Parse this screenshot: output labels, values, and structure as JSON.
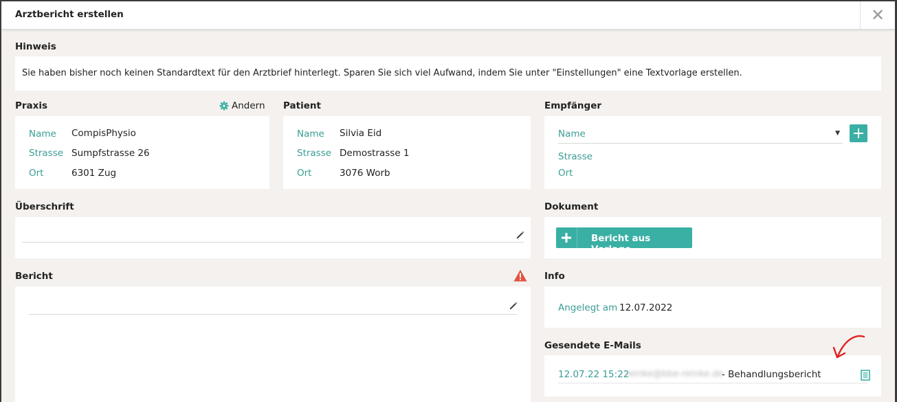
{
  "modal": {
    "title": "Arztbericht erstellen",
    "close_icon": "close-icon"
  },
  "hinweis": {
    "label": "Hinweis",
    "text": "Sie haben bisher noch keinen Standardtext für den Arztbrief hinterlegt. Sparen Sie sich viel Aufwand, indem Sie unter \"Einstellungen\" eine Textvorlage erstellen."
  },
  "praxis": {
    "label": "Praxis",
    "edit_label": "Andern",
    "rows": [
      {
        "key": "Name",
        "value": "CompisPhysio"
      },
      {
        "key": "Strasse",
        "value": "Sumpfstrasse 26"
      },
      {
        "key": "Ort",
        "value": "6301 Zug"
      }
    ]
  },
  "patient": {
    "label": "Patient",
    "rows": [
      {
        "key": "Name",
        "value": "Silvia Eid"
      },
      {
        "key": "Strasse",
        "value": "Demostrasse 1"
      },
      {
        "key": "Ort",
        "value": "3076 Worb"
      }
    ]
  },
  "empfaenger": {
    "label": "Empfänger",
    "name_placeholder": "Name",
    "strasse_label": "Strasse",
    "ort_label": "Ort"
  },
  "ueberschrift": {
    "label": "Überschrift",
    "value": ""
  },
  "dokument": {
    "label": "Dokument",
    "button_label": "Bericht aus Vorlage"
  },
  "bericht": {
    "label": "Bericht",
    "value": ""
  },
  "info": {
    "label": "Info",
    "created_key": "Angelegt am",
    "created_value": "12.07.2022"
  },
  "emails": {
    "label": "Gesendete E-Mails",
    "items": [
      {
        "time": "12.07.22 15:22",
        "address": "reinke@bbe-reinke.de",
        "subject": "- Behandlungsbericht"
      }
    ]
  },
  "colors": {
    "accent": "#3aafa4",
    "accent_text": "#3a9d94",
    "warning": "#e0533f",
    "annotation": "#e02020",
    "background": "#f4f1ee"
  }
}
